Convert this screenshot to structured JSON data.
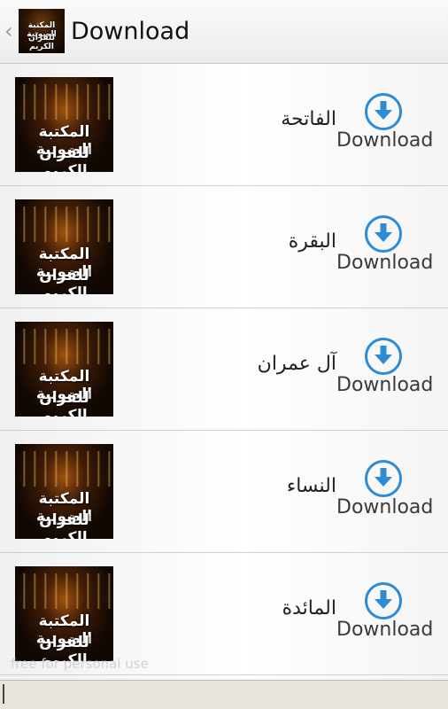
{
  "actionbar": {
    "title": "Download",
    "app_icon_caption_line1": "المكتبة الصوتية",
    "app_icon_caption_line2": "للقرآن الكريم"
  },
  "thumbnail": {
    "caption_line1": "المكتبة الصوتية",
    "caption_line2": "للقران الكريم"
  },
  "list": {
    "items": [
      {
        "name": "الفاتحة",
        "action_label": "Download",
        "icon": "download-arrow-icon"
      },
      {
        "name": "البقرة",
        "action_label": "Download",
        "icon": "download-arrow-icon"
      },
      {
        "name": "آل عمران",
        "action_label": "Download",
        "icon": "download-arrow-icon"
      },
      {
        "name": "النساء",
        "action_label": "Download",
        "icon": "download-arrow-icon"
      },
      {
        "name": "المائدة",
        "action_label": "Download",
        "icon": "download-arrow-icon"
      }
    ]
  },
  "watermark": "free for personal use",
  "colors": {
    "accent": "#2e8bd6",
    "text": "#222222"
  }
}
